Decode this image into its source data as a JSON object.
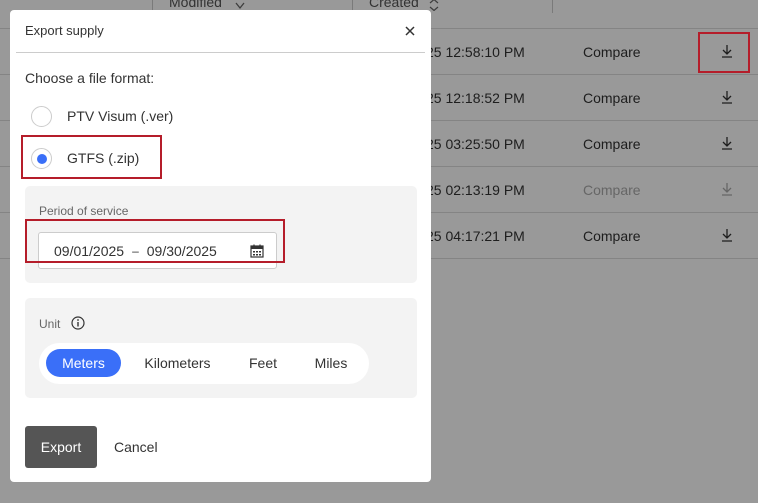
{
  "table": {
    "columns": [
      "Modified",
      "Created"
    ],
    "rows": [
      {
        "time": "25 12:58:10 PM",
        "compare": "Compare",
        "disabled": false
      },
      {
        "time": "25 12:18:52 PM",
        "compare": "Compare",
        "disabled": false
      },
      {
        "time": "25 03:25:50 PM",
        "compare": "Compare",
        "disabled": false
      },
      {
        "time": "25 02:13:19 PM",
        "compare": "Compare",
        "disabled": true
      },
      {
        "time": "25 04:17:21 PM",
        "compare": "Compare",
        "disabled": false
      }
    ]
  },
  "dialog": {
    "title": "Export supply",
    "choose_label": "Choose a file format:",
    "formats": [
      {
        "label": "PTV Visum (.ver)",
        "selected": false
      },
      {
        "label": "GTFS (.zip)",
        "selected": true
      }
    ],
    "period": {
      "label": "Period of service",
      "start": "09/01/2025",
      "separator": "–",
      "end": "09/30/2025"
    },
    "unit": {
      "label": "Unit",
      "options": [
        "Meters",
        "Kilometers",
        "Feet",
        "Miles"
      ],
      "selected": "Meters"
    },
    "export_label": "Export",
    "cancel_label": "Cancel"
  },
  "colors": {
    "accent": "#3a6ff8",
    "highlight": "#b51d2a",
    "export_button": "#555555"
  },
  "icons": [
    "close-icon",
    "calendar-icon",
    "info-icon",
    "download-icon",
    "sort-icon"
  ]
}
